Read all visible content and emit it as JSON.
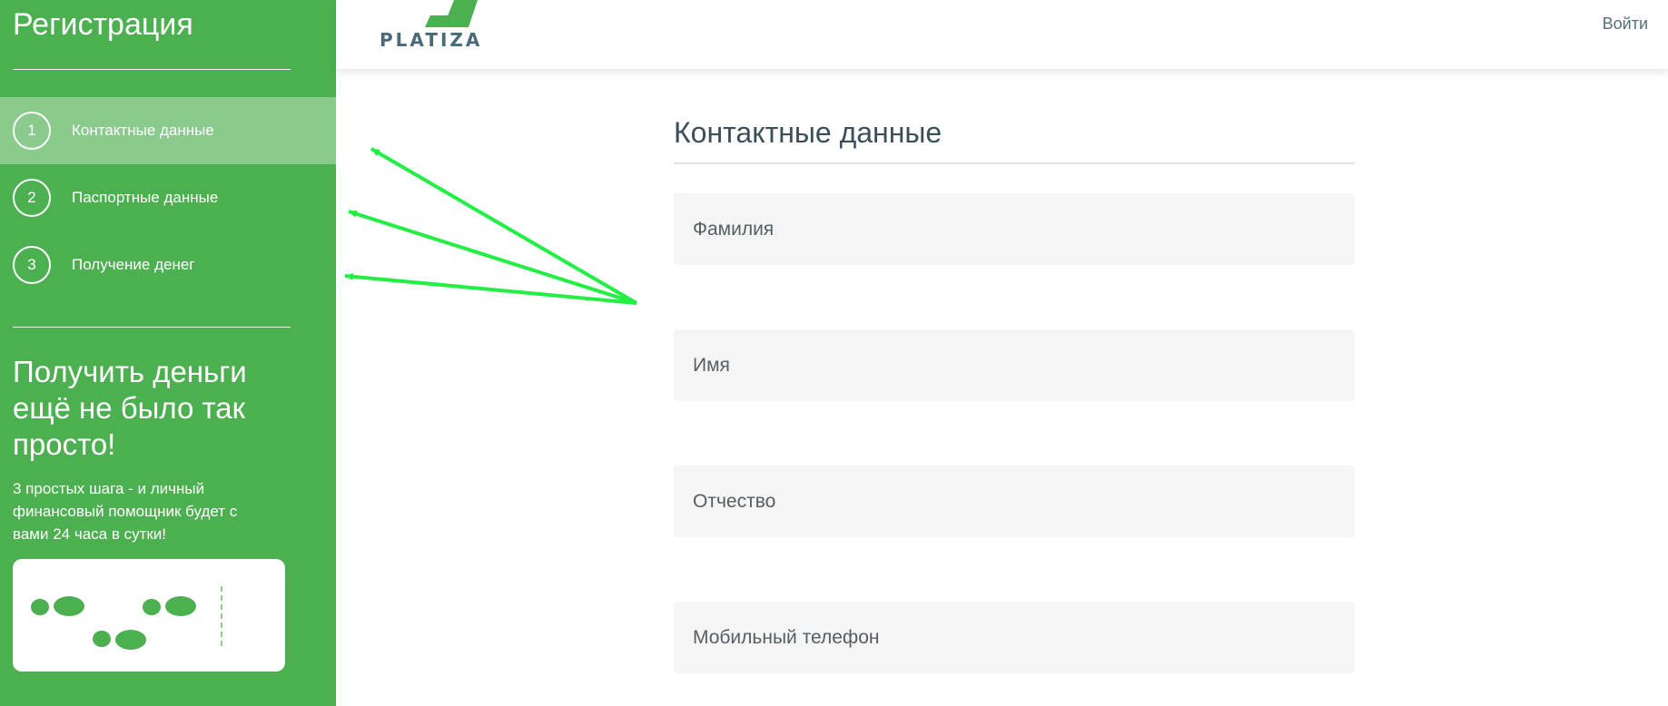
{
  "sidebar": {
    "title": "Регистрация",
    "steps": [
      {
        "number": "1",
        "label": "Контактные данные",
        "active": true
      },
      {
        "number": "2",
        "label": "Паспортные данные",
        "active": false
      },
      {
        "number": "3",
        "label": "Получение денег",
        "active": false
      }
    ],
    "promo_title": "Получить деньги ещё не было так просто!",
    "promo_text": "3 простых шага - и личный финансовый помощник будет с вами 24 часа в сутки!",
    "promo_icon": "footsteps-icon"
  },
  "header": {
    "logo_text": "PLATIZA",
    "login_label": "Войти"
  },
  "form": {
    "title": "Контактные данные",
    "fields": {
      "last_name": {
        "placeholder": "Фамилия",
        "value": ""
      },
      "first_name": {
        "placeholder": "Имя",
        "value": ""
      },
      "patronymic": {
        "placeholder": "Отчество",
        "value": ""
      },
      "phone": {
        "placeholder": "Мобильный телефон",
        "value": ""
      }
    }
  },
  "colors": {
    "sidebar_bg": "#4caf50",
    "active_step_bg": "#8fcf8b",
    "annotation_arrow": "#22ee44",
    "logo_green": "#4caf50",
    "logo_text": "#4a6a78"
  }
}
